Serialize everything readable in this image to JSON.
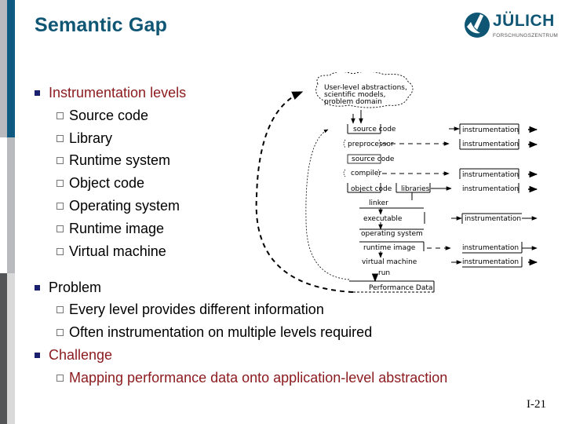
{
  "slide": {
    "title": "Semantic Gap",
    "page_number": "I-21"
  },
  "logo": {
    "name": "JÜLICH",
    "subtitle": "FORSCHUNGSZENTRUM",
    "brand_color": "#0f5574"
  },
  "colors": {
    "title": "#0f5574",
    "emphasis": "#8b1a1e",
    "bullet": "#1a1f6e",
    "sidebar_blue": "#0f5a80",
    "sidebar_grey": "#b9babd",
    "sidebar_dark": "#545557",
    "sidebar_light": "#d9d9d9"
  },
  "bullets": [
    {
      "label": "Instrumentation levels",
      "emphasis": true,
      "items": [
        "Source code",
        "Library",
        "Runtime system",
        "Object code",
        "Operating system",
        "Runtime image",
        "Virtual machine"
      ]
    },
    {
      "label": "Problem",
      "emphasis": false,
      "items": [
        "Every level provides different information",
        "Often instrumentation on multiple levels required"
      ]
    },
    {
      "label": "Challenge",
      "emphasis": true,
      "items": [
        "Mapping performance data onto application-level abstraction"
      ]
    }
  ],
  "diagram": {
    "cloud_lines": [
      "User-level abstractions,",
      "scientific models,",
      "problem domain"
    ],
    "stages": [
      "source code",
      "preprocessor",
      "source code",
      "compiler",
      "object code",
      "libraries",
      "linker",
      "executable",
      "operating system",
      "runtime image",
      "virtual machine"
    ],
    "run_label": "run",
    "output_label": "Performance Data",
    "instrumentation_label": "instrumentation"
  }
}
